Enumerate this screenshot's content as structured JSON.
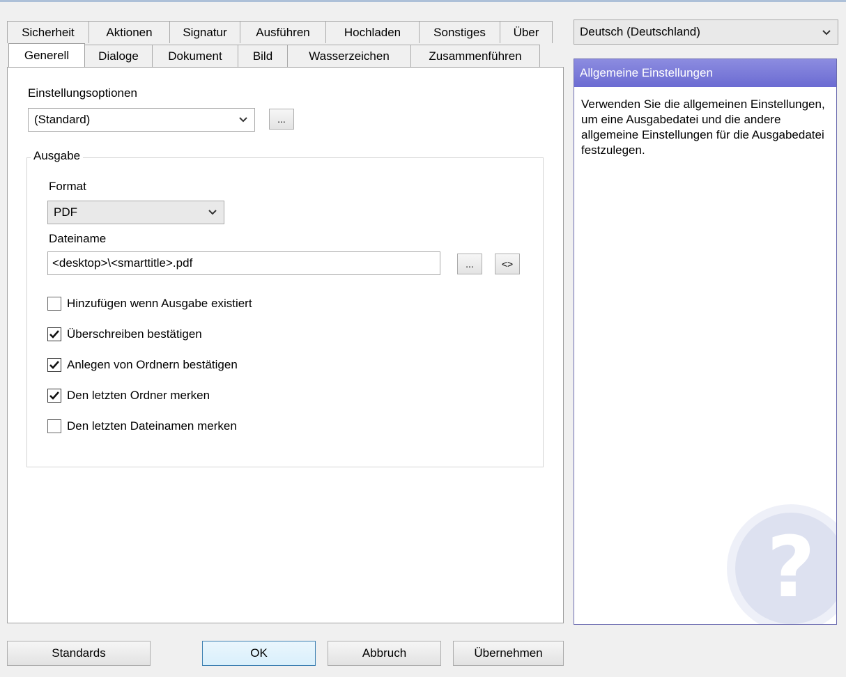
{
  "language_select": {
    "value": "Deutsch (Deutschland)"
  },
  "tabs_row_back": [
    {
      "label": "Sicherheit"
    },
    {
      "label": "Aktionen"
    },
    {
      "label": "Signatur"
    },
    {
      "label": "Ausführen"
    },
    {
      "label": "Hochladen"
    },
    {
      "label": "Sonstiges"
    },
    {
      "label": "Über"
    }
  ],
  "tabs_row_front": [
    {
      "label": "Generell",
      "active": true
    },
    {
      "label": "Dialoge"
    },
    {
      "label": "Dokument"
    },
    {
      "label": "Bild"
    },
    {
      "label": "Wasserzeichen"
    },
    {
      "label": "Zusammenführen"
    }
  ],
  "general": {
    "settings_label": "Einstellungsoptionen",
    "settings_value": "(Standard)",
    "settings_more_button": "...",
    "output_group_title": "Ausgabe",
    "format_label": "Format",
    "format_value": "PDF",
    "filename_label": "Dateiname",
    "filename_value": "<desktop>\\<smarttitle>.pdf",
    "filename_browse_button": "...",
    "filename_macro_button": "<>",
    "checkboxes": [
      {
        "label": "Hinzufügen wenn Ausgabe existiert",
        "checked": false
      },
      {
        "label": "Überschreiben bestätigen",
        "checked": true
      },
      {
        "label": "Anlegen von Ordnern bestätigen",
        "checked": true
      },
      {
        "label": "Den letzten Ordner merken",
        "checked": true
      },
      {
        "label": "Den letzten Dateinamen merken",
        "checked": false
      }
    ]
  },
  "help": {
    "title": "Allgemeine Einstellungen",
    "text": "Verwenden Sie die allgemeinen Einstellungen, um eine Ausgabedatei und die andere allgemeine Einstellungen für die Ausgabedatei festzulegen.",
    "watermark_icon": "question-mark-icon",
    "header_color": "#7777d8"
  },
  "buttons": {
    "defaults": "Standards",
    "ok": "OK",
    "cancel": "Abbruch",
    "apply": "Übernehmen"
  }
}
